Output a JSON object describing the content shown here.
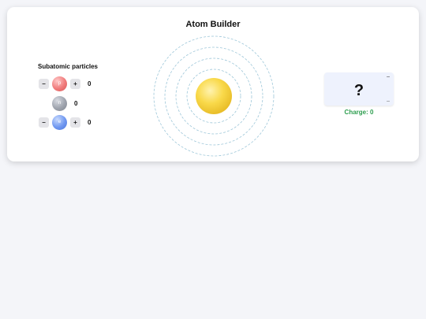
{
  "app": {
    "title": "Atom Builder"
  },
  "particles_panel": {
    "title": "Subatomic particles",
    "proton": {
      "label": "p",
      "count": "0",
      "minus": "−",
      "plus": "+"
    },
    "neutron": {
      "label": "n",
      "count": "0"
    },
    "electron": {
      "label": "e",
      "count": "0",
      "minus": "−",
      "plus": "+"
    }
  },
  "atom": {
    "orbit_count": 4,
    "nucleus_color": "#f9d94a",
    "orbit_color": "#9ec7d9"
  },
  "element": {
    "symbol": "?",
    "corner_top": "–",
    "corner_bottom": "–",
    "charge_text": "Charge: 0",
    "charge_color": "#2e9e4f",
    "box_color": "#eef2fd"
  }
}
